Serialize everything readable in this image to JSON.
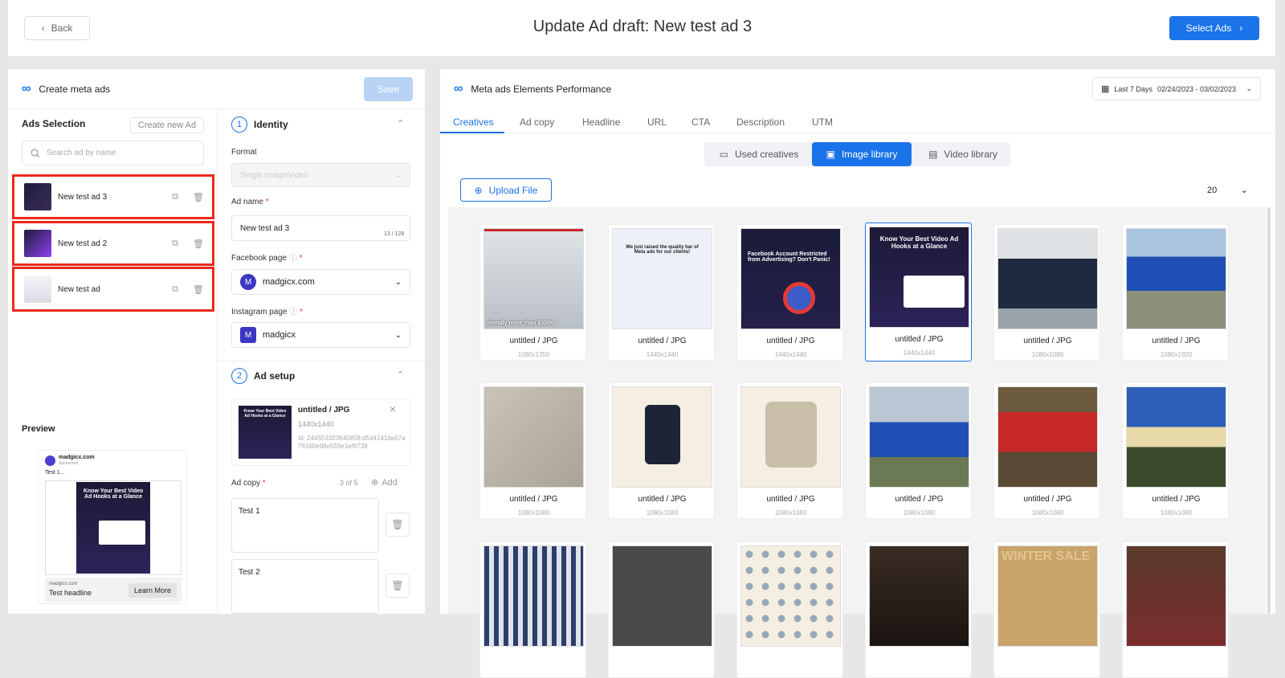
{
  "topbar": {
    "back": "Back",
    "title": "Update Ad draft: New test ad 3",
    "select_ads": "Select Ads"
  },
  "left": {
    "title": "Create meta ads",
    "save": "Save",
    "ads_selection": "Ads Selection",
    "create_new": "Create new Ad",
    "search_placeholder": "Search ad by name",
    "ads": [
      {
        "name": "New test ad 3"
      },
      {
        "name": "New test ad 2"
      },
      {
        "name": "New test ad"
      }
    ],
    "preview": {
      "label": "Preview",
      "page": "madgicx.com",
      "sponsored": "Sponsored",
      "text": "Test 1...",
      "img_title": "Know Your Best Video Ad Hooks at a Glance",
      "domain": "madgicx.com",
      "headline": "Test headline",
      "cta": "Learn More"
    }
  },
  "form": {
    "identity": {
      "num": "1",
      "title": "Identity",
      "format_label": "Format",
      "format_value": "Single image/video",
      "ad_name_label": "Ad name",
      "ad_name_value": "New test ad 3",
      "ad_name_count": "13 / 128",
      "fb_label": "Facebook page",
      "fb_value": "madgicx.com",
      "ig_label": "Instagram page",
      "ig_value": "madgicx"
    },
    "setup": {
      "num": "2",
      "title": "Ad setup",
      "media_name": "untitled / JPG",
      "media_size": "1440x1440",
      "media_id": "Id: 244553323640858:d5d4141da67a76160e98e559e1ef6739",
      "media_img_title": "Know Your Best Video Ad Hooks at a Glance",
      "ad_copy_label": "Ad copy",
      "ad_copy_count": "3 of 5",
      "add": "Add",
      "copies": [
        "Test 1",
        "Test 2"
      ]
    }
  },
  "right": {
    "title": "Meta ads Elements Performance",
    "date_range": "Last 7 Days",
    "date_values": "02/24/2023 - 03/02/2023",
    "tabs": [
      "Creatives",
      "Ad copy",
      "Headline",
      "URL",
      "CTA",
      "Description",
      "UTM"
    ],
    "segments": [
      "Used creatives",
      "Image library",
      "Video library"
    ],
    "upload": "Upload File",
    "page_size": "20",
    "tiles": [
      {
        "name": "untitled / JPG",
        "size": "1080x1350",
        "overlay": "literally more than $300K"
      },
      {
        "name": "untitled / JPG",
        "size": "1440x1440",
        "overlay": "We just raised the quality bar of Meta ads for our clients!"
      },
      {
        "name": "untitled / JPG",
        "size": "1440x1440",
        "overlay": "Facebook Account Restricted from Advertising? Don't Panic!"
      },
      {
        "name": "untitled / JPG",
        "size": "1440x1440",
        "overlay": "Know Your Best Video Ad Hooks at a Glance"
      },
      {
        "name": "untitled / JPG",
        "size": "1080x1080",
        "overlay": ""
      },
      {
        "name": "untitled / JPG",
        "size": "1080x1920",
        "overlay": ""
      },
      {
        "name": "untitled / JPG",
        "size": "1080x1080",
        "overlay": ""
      },
      {
        "name": "untitled / JPG",
        "size": "1080x1080",
        "overlay": ""
      },
      {
        "name": "untitled / JPG",
        "size": "1080x1080",
        "overlay": ""
      },
      {
        "name": "untitled / JPG",
        "size": "1080x1080",
        "overlay": ""
      },
      {
        "name": "untitled / JPG",
        "size": "1080x1080",
        "overlay": ""
      },
      {
        "name": "untitled / JPG",
        "size": "1080x1080",
        "overlay": ""
      },
      {
        "overlay": ""
      },
      {
        "overlay": ""
      },
      {
        "overlay": ""
      },
      {
        "overlay": ""
      },
      {
        "overlay": "WINTER SALE"
      },
      {
        "overlay": ""
      }
    ]
  }
}
